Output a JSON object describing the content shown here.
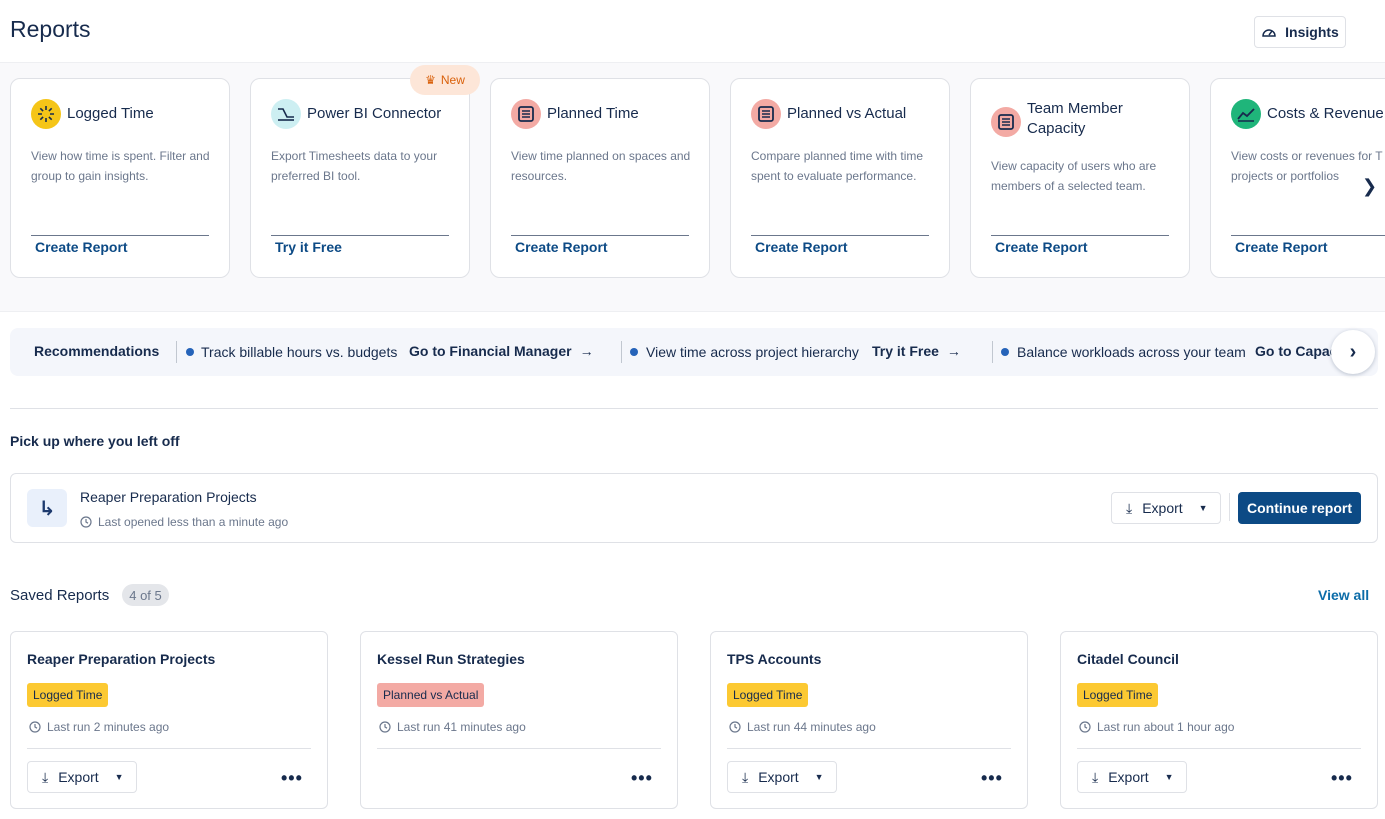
{
  "header": {
    "title": "Reports",
    "insights_label": "Insights"
  },
  "report_types": [
    {
      "title": "Logged Time",
      "description": "View how time is spent. Filter and group to gain insights.",
      "cta": "Create Report",
      "icon": "logged-time-icon",
      "color": "#f5c518"
    },
    {
      "title": "Power BI Connector",
      "description": "Export Timesheets data to your preferred BI tool.",
      "cta": "Try it Free",
      "icon": "power-bi-icon",
      "color": "#cdeff2",
      "badge": "New"
    },
    {
      "title": "Planned Time",
      "description": "View time planned on spaces and resources.",
      "cta": "Create Report",
      "icon": "planned-time-icon",
      "color": "#f3aaa4"
    },
    {
      "title": "Planned vs Actual",
      "description": "Compare planned time with time spent to evaluate performance.",
      "cta": "Create Report",
      "icon": "planned-vs-actual-icon",
      "color": "#f3aaa4"
    },
    {
      "title": "Team Member Capacity",
      "description": "View capacity of users who are members of a selected team.",
      "cta": "Create Report",
      "icon": "capacity-icon",
      "color": "#f3aaa4"
    },
    {
      "title": "Costs & Revenue",
      "description": "View costs or revenues for T projects or portfolios",
      "cta": "Create Report",
      "icon": "costs-icon",
      "color": "#1fb57a"
    }
  ],
  "recommendations": {
    "label": "Recommendations",
    "items": [
      {
        "text": "Track billable hours vs. budgets",
        "link": "Go to Financial Manager"
      },
      {
        "text": "View time across project hierarchy",
        "link": "Try it Free"
      },
      {
        "text": "Balance workloads across your team",
        "link": "Go to Capac"
      }
    ]
  },
  "continue_section": {
    "title": "Pick up where you left off",
    "report_name": "Reaper Preparation Projects",
    "last_opened": "Last opened less than a minute ago",
    "export_label": "Export",
    "continue_label": "Continue report"
  },
  "saved_reports": {
    "title": "Saved Reports",
    "count": "4 of 5",
    "view_all": "View all",
    "items": [
      {
        "name": "Reaper Preparation Projects",
        "tag": "Logged Time",
        "last_run": "Last run 2 minutes ago",
        "export_label": "Export"
      },
      {
        "name": "Kessel Run Strategies",
        "tag": "Planned vs Actual",
        "last_run": "Last run 41 minutes ago"
      },
      {
        "name": "TPS Accounts",
        "tag": "Logged Time",
        "last_run": "Last run 44 minutes ago",
        "export_label": "Export"
      },
      {
        "name": "Citadel Council",
        "tag": "Logged Time",
        "last_run": "Last run about 1 hour ago",
        "export_label": "Export"
      }
    ]
  }
}
